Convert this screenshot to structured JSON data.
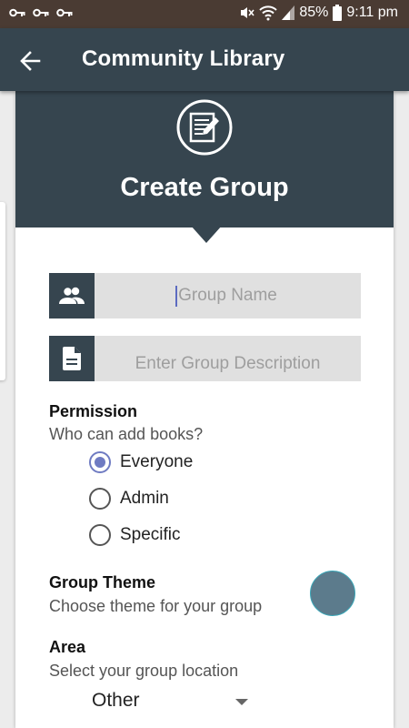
{
  "status_bar": {
    "icons": [
      "key-icon",
      "key-icon",
      "key-icon",
      "mute-icon",
      "wifi-icon",
      "signal-icon",
      "battery-icon"
    ],
    "battery": "85%",
    "time": "9:11 pm"
  },
  "app_bar": {
    "back_icon": "arrow-left-icon",
    "title": "Community Library"
  },
  "header": {
    "icon": "edit-document-icon",
    "title": "Create Group"
  },
  "form": {
    "group_name": {
      "icon": "group-icon",
      "placeholder": "Group Name",
      "value": ""
    },
    "group_description": {
      "icon": "document-icon",
      "placeholder": "Enter Group Description",
      "value": ""
    }
  },
  "permission": {
    "title": "Permission",
    "subtitle": "Who can add books?",
    "options": [
      {
        "label": "Everyone",
        "selected": true
      },
      {
        "label": "Admin",
        "selected": false
      },
      {
        "label": "Specific",
        "selected": false
      }
    ]
  },
  "theme": {
    "title": "Group Theme",
    "subtitle": "Choose theme for your group",
    "color": "#5c7b8c"
  },
  "area": {
    "title": "Area",
    "subtitle": "Select your group location",
    "selected": "Other"
  },
  "colors": {
    "primary": "#36454f",
    "accent": "#6f7bc2",
    "status_bar": "#4a3b33"
  }
}
